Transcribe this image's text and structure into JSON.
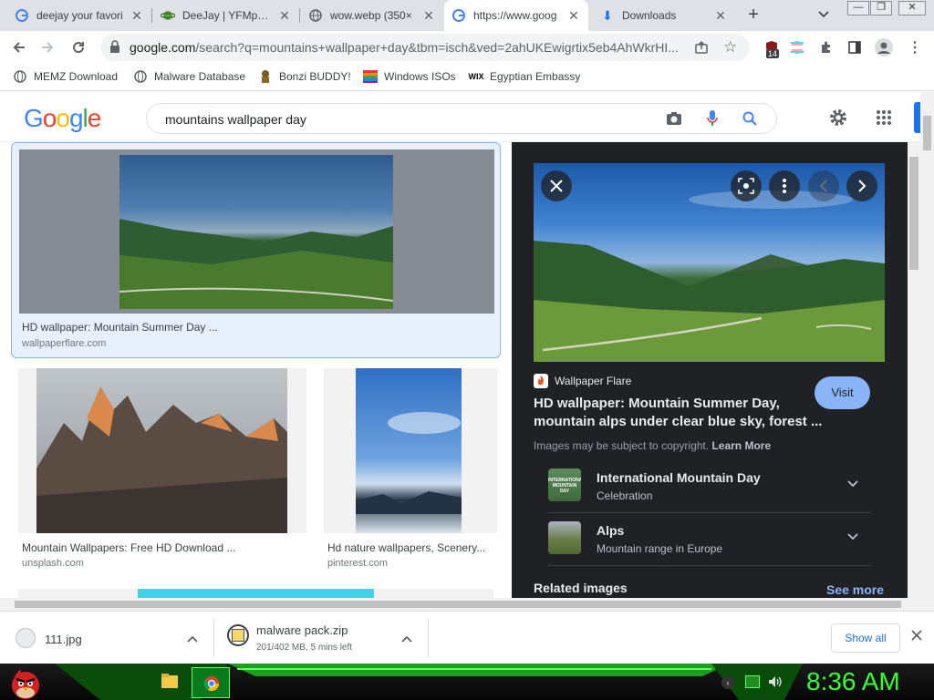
{
  "tabs": [
    {
      "title": "deejay your favori",
      "icon": "google-icon"
    },
    {
      "title": "DeeJay | YFMpedi",
      "icon": "planet-icon"
    },
    {
      "title": "wow.webp (350×",
      "icon": "globe-icon"
    },
    {
      "title": "https://www.goog",
      "icon": "google-icon"
    },
    {
      "title": "Downloads",
      "icon": "download-icon"
    }
  ],
  "omnibox": {
    "host": "google.com",
    "path": "/search?q=mountains+wallpaper+day&tbm=isch&ved=2ahUKEwigrtix5eb4AhWkrHI..."
  },
  "extension_badge": "14",
  "bookmarks": [
    {
      "label": "MEMZ Download",
      "icon": "globe-icon"
    },
    {
      "label": "Malware Database",
      "icon": "globe-icon"
    },
    {
      "label": "Bonzi BUDDY!",
      "icon": "bonzi-icon"
    },
    {
      "label": "Windows ISOs",
      "icon": "windows-flag-icon"
    },
    {
      "label": "Egyptian Embassy",
      "icon": "wix-icon"
    }
  ],
  "google": {
    "logo": "Google",
    "query": "mountains wallpaper day"
  },
  "results": [
    {
      "caption": "HD wallpaper: Mountain Summer Day ...",
      "source": "wallpaperflare.com"
    },
    {
      "caption": "Mountain Wallpapers: Free HD Download ...",
      "source": "unsplash.com"
    },
    {
      "caption": "Hd nature wallpapers, Scenery...",
      "source": "pinterest.com"
    }
  ],
  "preview": {
    "site": "Wallpaper Flare",
    "visit": "Visit",
    "title_line1": "HD wallpaper: Mountain Summer Day,",
    "title_line2": "mountain alps under clear blue sky, forest ...",
    "copyright": "Images may be subject to copyright.",
    "learn_more": "Learn More",
    "entities": [
      {
        "title": "International Mountain Day",
        "subtitle": "Celebration",
        "thumb_text": "INTERNATIONAL MOUNTAIN DAY"
      },
      {
        "title": "Alps",
        "subtitle": "Mountain range in Europe"
      }
    ],
    "related": "Related images",
    "see_more": "See more"
  },
  "downloads": [
    {
      "name": "111.jpg",
      "status": ""
    },
    {
      "name": "malware pack.zip",
      "status": "201/402 MB, 5 mins left"
    }
  ],
  "show_all": "Show all",
  "clock": "8:36 AM",
  "colors": {
    "accent": "#1a73e8",
    "visit_bg": "#8ab4f8",
    "clock": "#33ff33",
    "panel_bg": "#202124"
  }
}
